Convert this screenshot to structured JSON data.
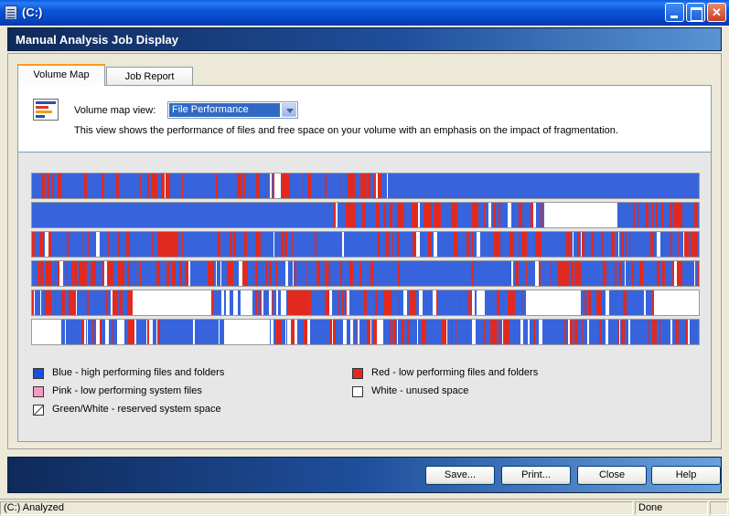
{
  "window": {
    "title": "(C:)"
  },
  "header": {
    "title": "Manual Analysis Job Display"
  },
  "tabs": [
    {
      "label": "Volume Map",
      "active": true
    },
    {
      "label": "Job Report",
      "active": false
    }
  ],
  "view": {
    "label": "Volume map view:",
    "selected": "File Performance",
    "description": "This view shows the performance of files and free space on your volume with an emphasis on the impact of fragmentation."
  },
  "legend": [
    {
      "color": "#1c4fd8",
      "label": "Blue - high performing files and folders"
    },
    {
      "color": "#f49ac4",
      "label": "Pink - low performing system files"
    },
    {
      "color": "hatched",
      "label": "Green/White - reserved system space"
    },
    {
      "color": "#e02a20",
      "label": "Red - low performing files and folders"
    },
    {
      "color": "#ffffff",
      "label": "White - unused space"
    }
  ],
  "colors": {
    "blue": "#1c4fd8",
    "red": "#e02a20",
    "white": "#ffffff",
    "pink": "#f49ac4",
    "reserved": "#9ac89a"
  },
  "buttons": {
    "save": "Save...",
    "print": "Print...",
    "close": "Close",
    "help": "Help"
  },
  "status": {
    "left": "(C:) Analyzed",
    "right": "Done"
  }
}
